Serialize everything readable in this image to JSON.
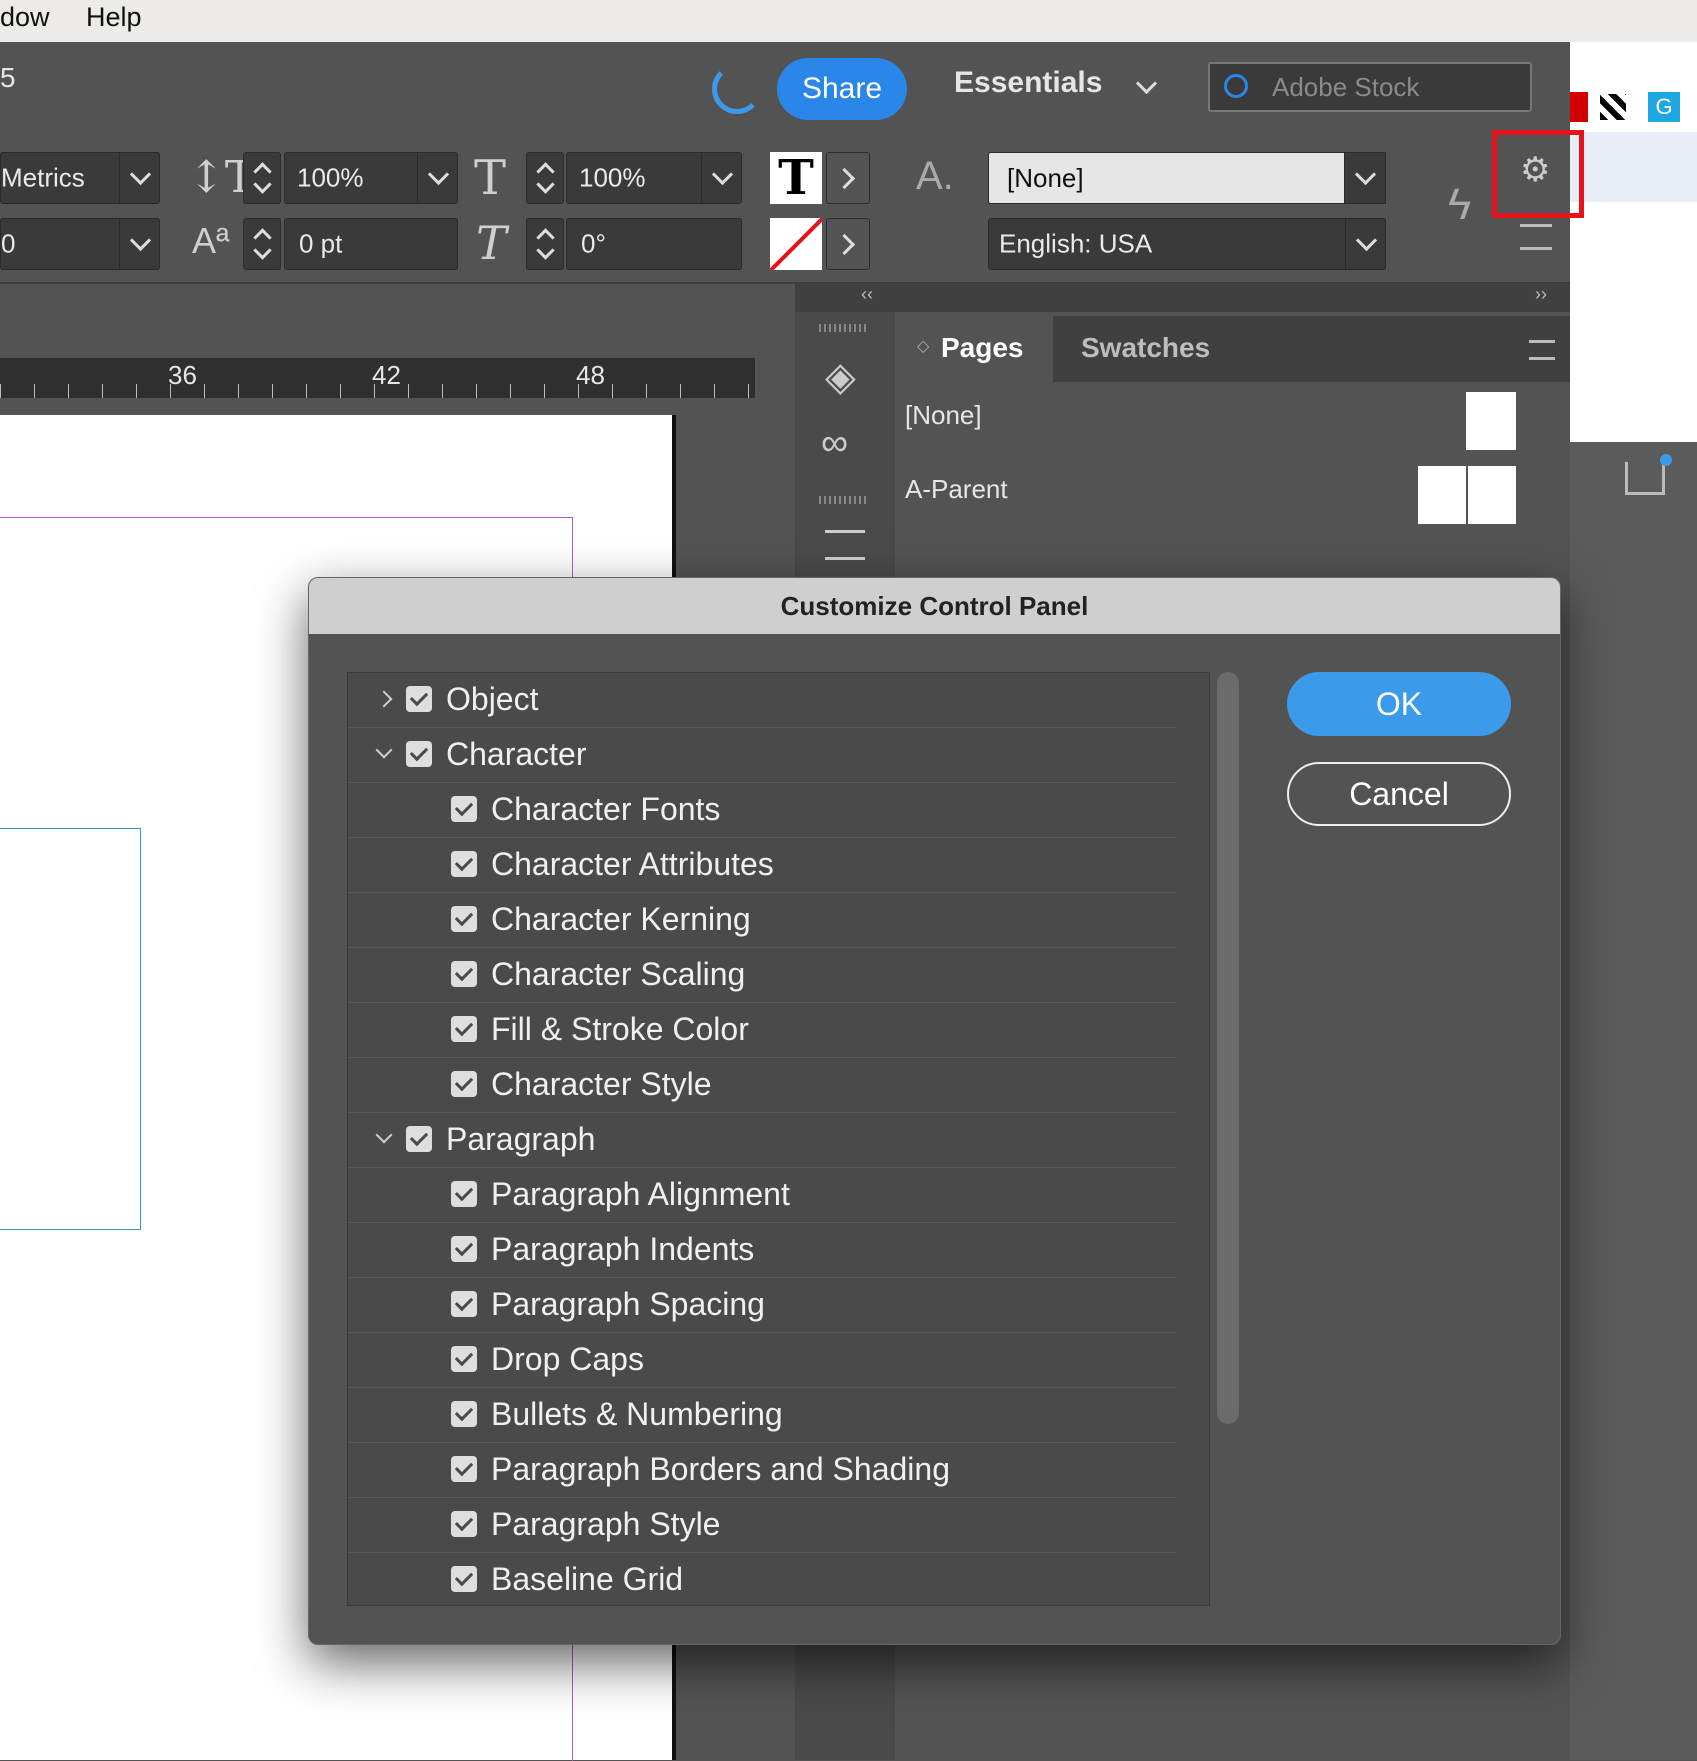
{
  "menubar": {
    "items": [
      "dow",
      "Help"
    ]
  },
  "topbar": {
    "title_fragment": "5",
    "share_label": "Share",
    "workspace_label": "Essentials",
    "search_placeholder": "Adobe Stock"
  },
  "control_panel": {
    "kerning_value": "Metrics",
    "tracking_value": "0",
    "vertical_scale": "100%",
    "baseline_shift": "0 pt",
    "horizontal_scale": "100%",
    "skew": "0°",
    "char_style": "[None]",
    "language": "English: USA",
    "char_style_icon": "A."
  },
  "ruler": {
    "ticks": [
      "36",
      "42",
      "48"
    ]
  },
  "panel": {
    "tabs": [
      "Pages",
      "Swatches"
    ],
    "items": [
      "[None]",
      "A-Parent"
    ]
  },
  "dialog": {
    "title": "Customize Control Panel",
    "ok_label": "OK",
    "cancel_label": "Cancel",
    "items": [
      {
        "label": "Object",
        "level": 0,
        "expanded": false,
        "checked": true
      },
      {
        "label": "Character",
        "level": 0,
        "expanded": true,
        "checked": true
      },
      {
        "label": "Character Fonts",
        "level": 1,
        "checked": true
      },
      {
        "label": "Character Attributes",
        "level": 1,
        "checked": true
      },
      {
        "label": "Character Kerning",
        "level": 1,
        "checked": true
      },
      {
        "label": "Character Scaling",
        "level": 1,
        "checked": true
      },
      {
        "label": "Fill & Stroke Color",
        "level": 1,
        "checked": true
      },
      {
        "label": "Character Style",
        "level": 1,
        "checked": true
      },
      {
        "label": "Paragraph",
        "level": 0,
        "expanded": true,
        "checked": true
      },
      {
        "label": "Paragraph Alignment",
        "level": 1,
        "checked": true
      },
      {
        "label": "Paragraph Indents",
        "level": 1,
        "checked": true
      },
      {
        "label": "Paragraph Spacing",
        "level": 1,
        "checked": true
      },
      {
        "label": "Drop Caps",
        "level": 1,
        "checked": true
      },
      {
        "label": "Bullets & Numbering",
        "level": 1,
        "checked": true
      },
      {
        "label": "Paragraph Borders and Shading",
        "level": 1,
        "checked": true
      },
      {
        "label": "Paragraph Style",
        "level": 1,
        "checked": true
      },
      {
        "label": "Baseline Grid",
        "level": 1,
        "checked": true
      }
    ]
  },
  "colors": {
    "accent": "#3b9bea",
    "highlight": "#e5131c"
  }
}
